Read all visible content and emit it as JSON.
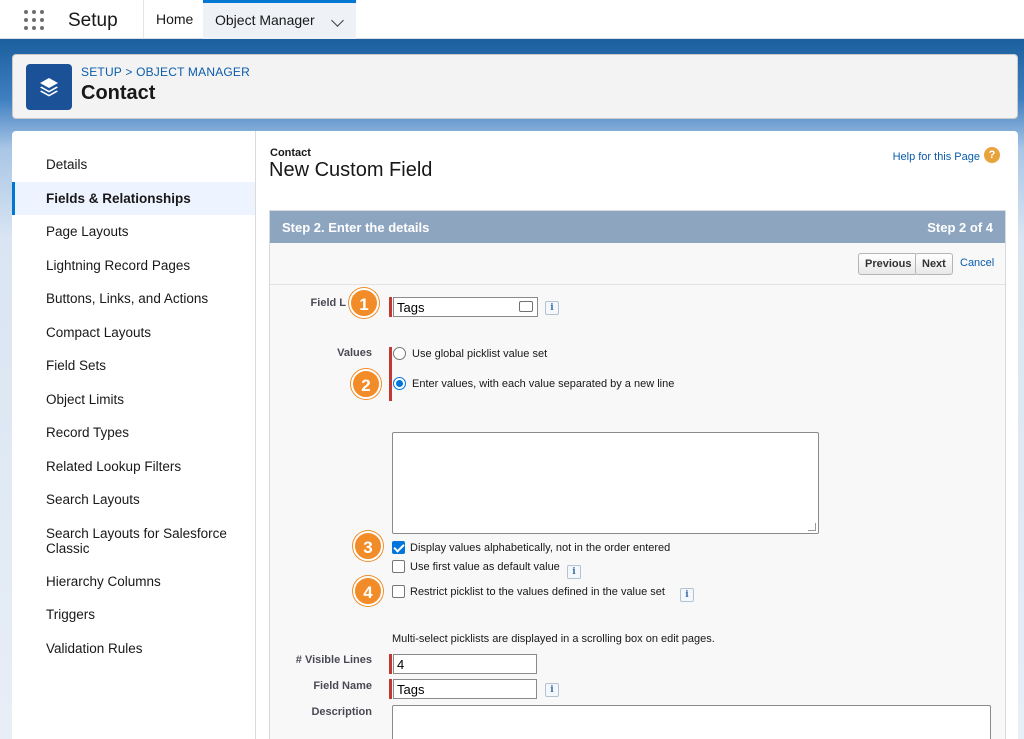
{
  "nav": {
    "app_name": "Setup",
    "tabs": [
      {
        "label": "Home"
      },
      {
        "label": "Object Manager"
      }
    ]
  },
  "header": {
    "breadcrumb": "SETUP > OBJECT MANAGER",
    "title": "Contact",
    "icon": "layers-icon"
  },
  "sidebar": {
    "items": [
      {
        "label": "Details"
      },
      {
        "label": "Fields & Relationships"
      },
      {
        "label": "Page Layouts"
      },
      {
        "label": "Lightning Record Pages"
      },
      {
        "label": "Buttons, Links, and Actions"
      },
      {
        "label": "Compact Layouts"
      },
      {
        "label": "Field Sets"
      },
      {
        "label": "Object Limits"
      },
      {
        "label": "Record Types"
      },
      {
        "label": "Related Lookup Filters"
      },
      {
        "label": "Search Layouts"
      },
      {
        "label": "Search Layouts for Salesforce Classic"
      },
      {
        "label": "Hierarchy Columns"
      },
      {
        "label": "Triggers"
      },
      {
        "label": "Validation Rules"
      }
    ],
    "active": "Fields & Relationships"
  },
  "content": {
    "object_label": "Contact",
    "form_title": "New Custom Field",
    "help_link": "Help for this Page",
    "help_icon_glyph": "?",
    "step_title": "Step 2. Enter the details",
    "step_count": "Step 2 of 4",
    "buttons": {
      "previous": "Previous",
      "next": "Next",
      "cancel": "Cancel"
    },
    "info_glyph": "i",
    "field_label": {
      "label": "Field L",
      "value": "Tags"
    },
    "values": {
      "label": "Values",
      "option_global": "Use global picklist value set",
      "option_enter": "Enter values, with each value separated by a new line",
      "selected": "option_enter",
      "textarea_value": ""
    },
    "checkboxes": {
      "alphabetical": {
        "label": "Display values alphabetically, not in the order entered",
        "checked": true
      },
      "first_default": {
        "label": "Use first value as default value",
        "checked": false
      },
      "restrict": {
        "label": "Restrict picklist to the values defined in the value set",
        "checked": false
      }
    },
    "multiselect_note": "Multi-select picklists are displayed in a scrolling box on edit pages.",
    "visible_lines": {
      "label": "# Visible Lines",
      "value": "4"
    },
    "field_name": {
      "label": "Field Name",
      "value": "Tags"
    },
    "description": {
      "label": "Description",
      "value": ""
    },
    "badges": [
      "1",
      "2",
      "3",
      "4"
    ],
    "colors": {
      "brand_blue": "#0176d3",
      "badge_orange": "#f28c28",
      "step_header": "#8ea5c0",
      "required_bar": "#c23934"
    }
  }
}
